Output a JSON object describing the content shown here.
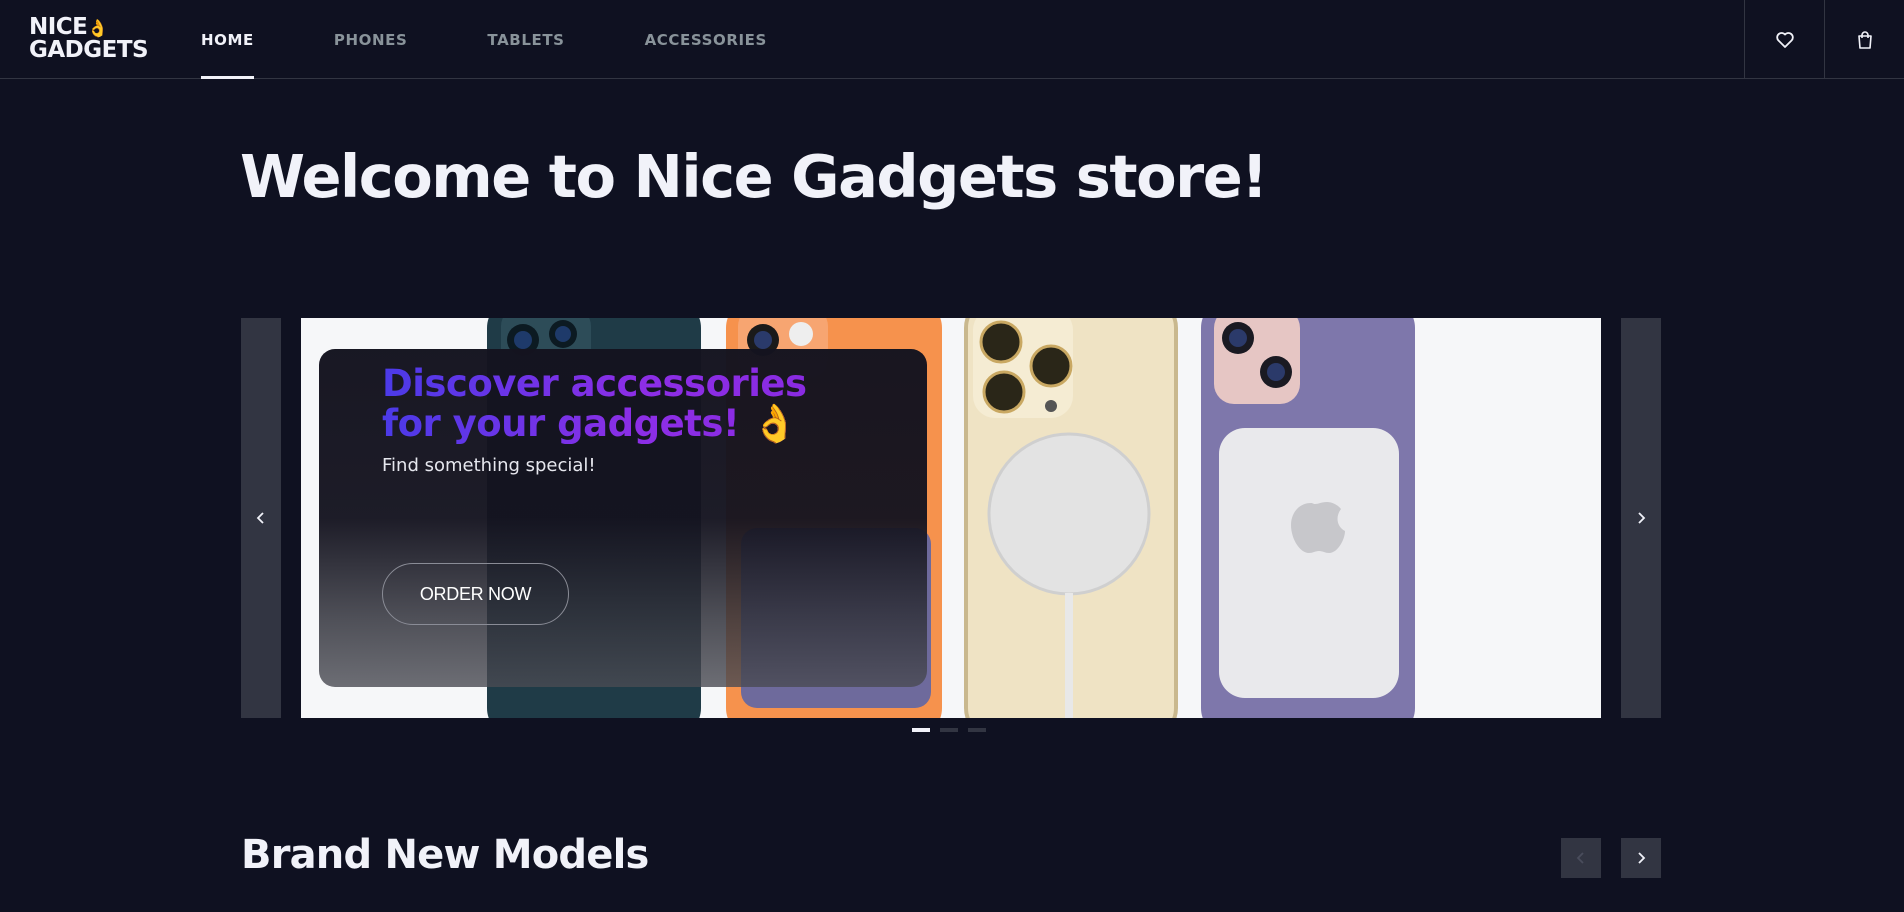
{
  "header": {
    "logo_line1": "NICE",
    "logo_emoji": "👌",
    "logo_line2": "GADGETS",
    "nav": [
      {
        "label": "HOME",
        "active": true
      },
      {
        "label": "PHONES",
        "active": false
      },
      {
        "label": "TABLETS",
        "active": false
      },
      {
        "label": "ACCESSORIES",
        "active": false
      }
    ],
    "icons": [
      "heart-icon",
      "shopping-bag-icon"
    ]
  },
  "main": {
    "title": "Welcome to Nice Gadgets store!",
    "banner": {
      "title_line1": "Discover accessories",
      "title_line2": "for your gadgets!",
      "title_emoji": "👌",
      "subtitle": "Find something special!",
      "cta": "ORDER NOW",
      "slides": 3,
      "active_slide": 1
    },
    "section": {
      "title": "Brand New Models"
    }
  },
  "colors": {
    "background": "#0f1121",
    "surface": "#323542",
    "text_primary": "#f1f2f9",
    "text_secondary": "#89939a",
    "accent_gradient_start": "#4b3ae8",
    "accent_gradient_end": "#8a2be2"
  }
}
